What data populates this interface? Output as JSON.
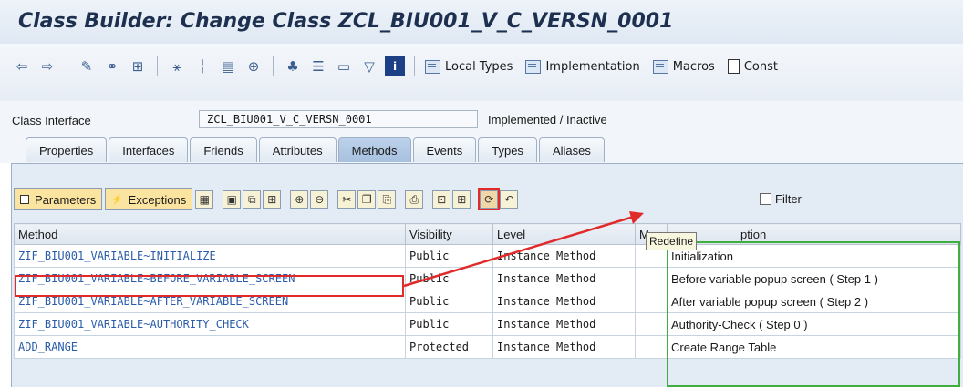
{
  "window": {
    "title": "Class Builder: Change Class ZCL_BIU001_V_C_VERSN_0001"
  },
  "toolbar": {
    "icons": [
      "back-icon",
      "forward-icon",
      "edit-icon",
      "display-object-icon",
      "where-used-icon",
      "hierarchy-icon",
      "check-icon",
      "activate-icon",
      "test-icon",
      "navigation-icon",
      "other-object-icon",
      "tree-icon",
      "window-icon",
      "filter-icon",
      "info-icon"
    ],
    "local_types": "Local Types",
    "implementation": "Implementation",
    "macros": "Macros",
    "constructor_partial": "Const"
  },
  "header": {
    "class_interface_label": "Class Interface",
    "class_interface_value": "ZCL_BIU001_V_C_VERSN_0001",
    "status": "Implemented / Inactive"
  },
  "tabs": [
    {
      "label": "Properties",
      "active": false
    },
    {
      "label": "Interfaces",
      "active": false
    },
    {
      "label": "Friends",
      "active": false
    },
    {
      "label": "Attributes",
      "active": false
    },
    {
      "label": "Methods",
      "active": true
    },
    {
      "label": "Events",
      "active": false
    },
    {
      "label": "Types",
      "active": false
    },
    {
      "label": "Aliases",
      "active": false
    }
  ],
  "methods_toolbar": {
    "parameters": "Parameters",
    "exceptions": "Exceptions",
    "filter": "Filter",
    "redefine_tooltip": "Redefine"
  },
  "table": {
    "columns": [
      "Method",
      "Visibility",
      "Level",
      "M",
      "Description"
    ],
    "description_visible": "ption",
    "rows": [
      {
        "method": "ZIF_BIU001_VARIABLE~INITIALIZE",
        "visibility": "Public",
        "level": "Instance Method",
        "description": "Initialization"
      },
      {
        "method": "ZIF_BIU001_VARIABLE~BEFORE_VARIABLE_SCREEN",
        "visibility": "Public",
        "level": "Instance Method",
        "description": "Before variable popup screen ( Step 1 )"
      },
      {
        "method": "ZIF_BIU001_VARIABLE~AFTER_VARIABLE_SCREEN",
        "visibility": "Public",
        "level": "Instance Method",
        "description": "After variable popup screen ( Step 2 )"
      },
      {
        "method": "ZIF_BIU001_VARIABLE~AUTHORITY_CHECK",
        "visibility": "Public",
        "level": "Instance Method",
        "description": "Authority-Check ( Step 0 )"
      },
      {
        "method": "ADD_RANGE",
        "visibility": "Protected",
        "level": "Instance Method",
        "description": "Create Range Table"
      }
    ]
  },
  "colors": {
    "highlight_red": "#e12a2a",
    "highlight_green": "#3fae3f",
    "method_link": "#2b5dab",
    "active_tab": "#a7c1e0"
  }
}
